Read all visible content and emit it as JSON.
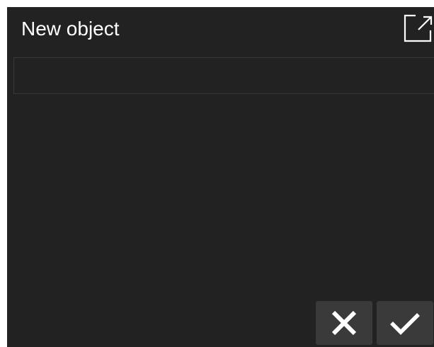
{
  "dialog": {
    "title": "New object",
    "name_value": "",
    "name_placeholder": ""
  },
  "actions": {
    "expand_icon": "open-in-new-icon",
    "cancel_icon": "close-icon",
    "confirm_icon": "check-icon"
  },
  "colors": {
    "background": "#222222",
    "button": "#3a3a3a",
    "text": "#ffffff",
    "field_border": "#383838"
  }
}
